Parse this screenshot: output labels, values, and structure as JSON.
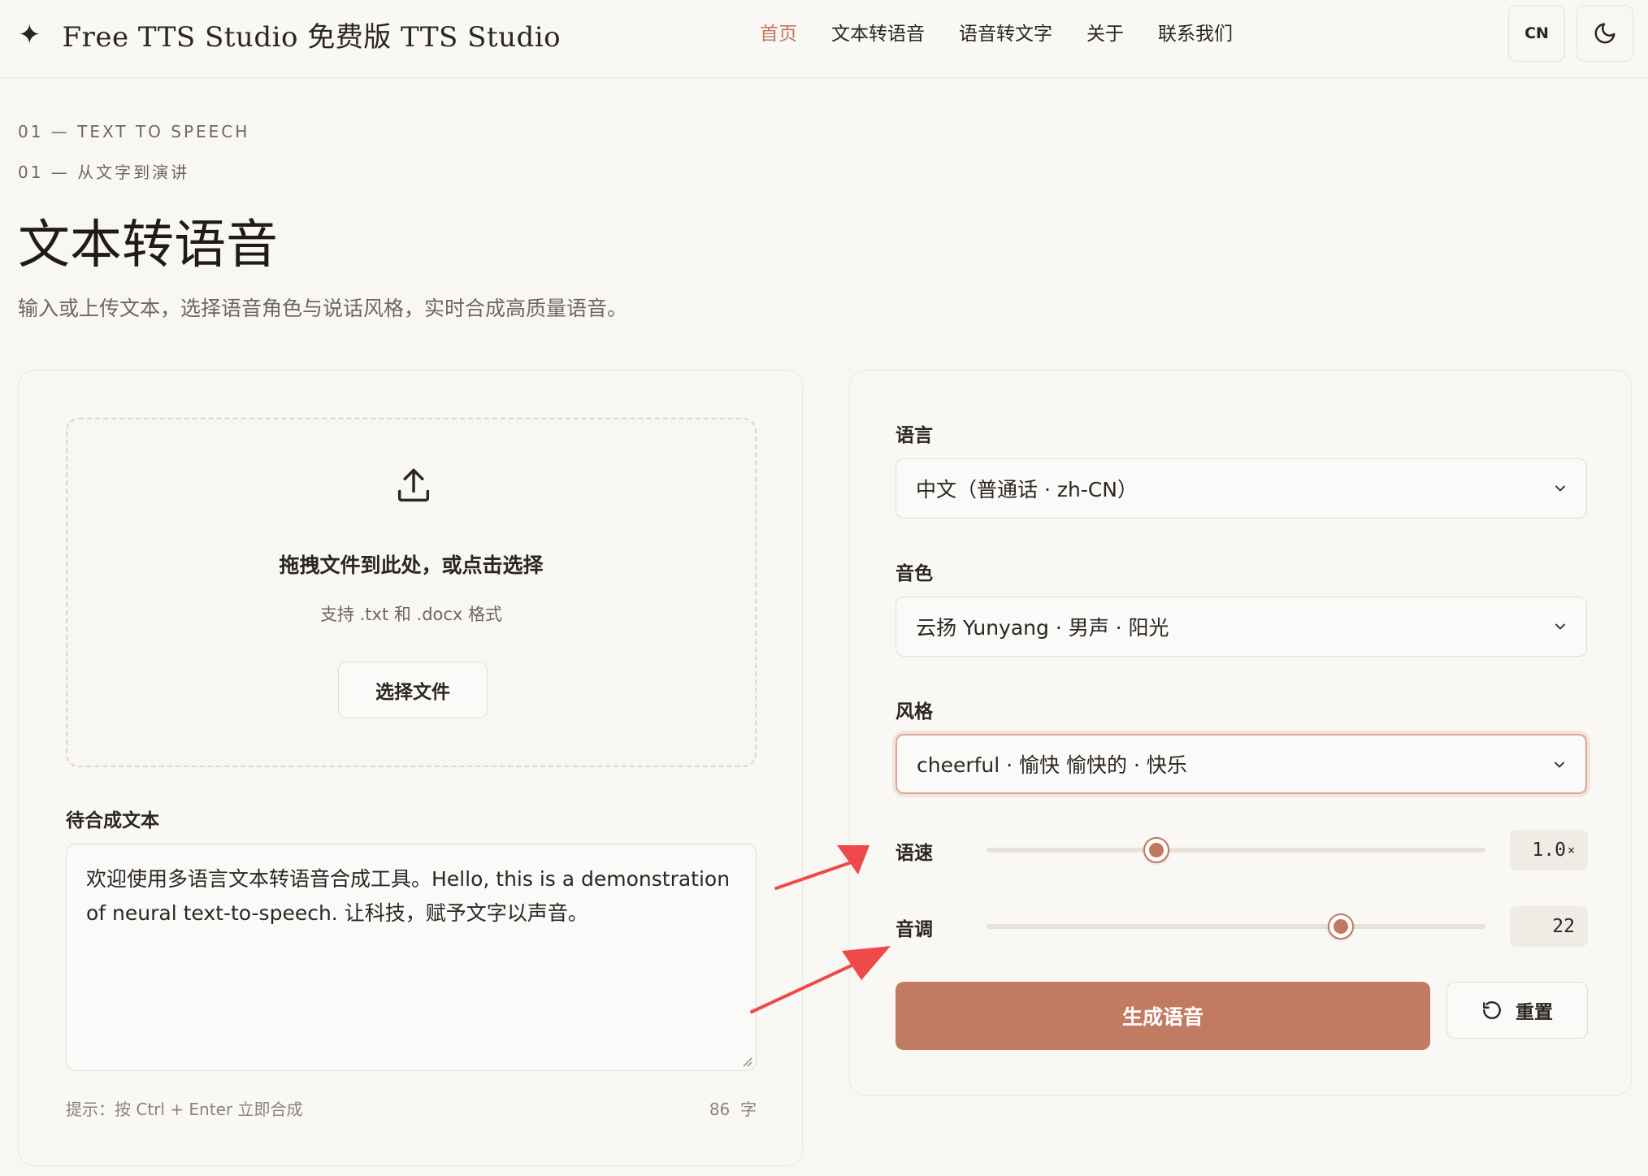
{
  "header": {
    "brand_mark": "✦",
    "brand_name": "Free TTS Studio 免费版 TTS Studio",
    "nav": [
      {
        "label": "首页",
        "active": true
      },
      {
        "label": "文本转语音",
        "active": false
      },
      {
        "label": "语音转文字",
        "active": false
      },
      {
        "label": "关于",
        "active": false
      },
      {
        "label": "联系我们",
        "active": false
      }
    ],
    "lang_toggle": "CN",
    "theme_icon": "moon-icon"
  },
  "hero": {
    "eyebrow_en": "01 — TEXT TO SPEECH",
    "eyebrow_zh": "01 — 从文字到演讲",
    "title": "文本转语音",
    "subtitle": "输入或上传文本，选择语音角色与说话风格，实时合成高质量语音。"
  },
  "upload": {
    "icon": "upload-icon",
    "title": "拖拽文件到此处，或点击选择",
    "hint": "支持 .txt 和 .docx 格式",
    "button": "选择文件"
  },
  "editor": {
    "label": "待合成文本",
    "text": "欢迎使用多语言文本转语音合成工具。Hello, this is a demonstration of neural text-to-speech. 让科技，赋予文字以声音。",
    "tip": "提示：按 Ctrl + Enter 立即合成",
    "char_count": "86",
    "char_unit": "字"
  },
  "settings": {
    "language": {
      "label": "语言",
      "value": "中文（普通话 · zh-CN）"
    },
    "voice": {
      "label": "音色",
      "value": "云扬 Yunyang · 男声 · 阳光"
    },
    "style": {
      "label": "风格",
      "value": "cheerful · 愉快  愉快的 · 快乐"
    },
    "rate": {
      "label": "语速",
      "value": "1.0",
      "unit": "×",
      "position": 0.34
    },
    "pitch": {
      "label": "音调",
      "value": "22",
      "position": 0.71
    }
  },
  "actions": {
    "generate": "生成语音",
    "reset": "重置"
  },
  "colors": {
    "accent": "#c27b63",
    "annotation_arrow": "#ef4a4a",
    "background": "#f9f7f4"
  }
}
